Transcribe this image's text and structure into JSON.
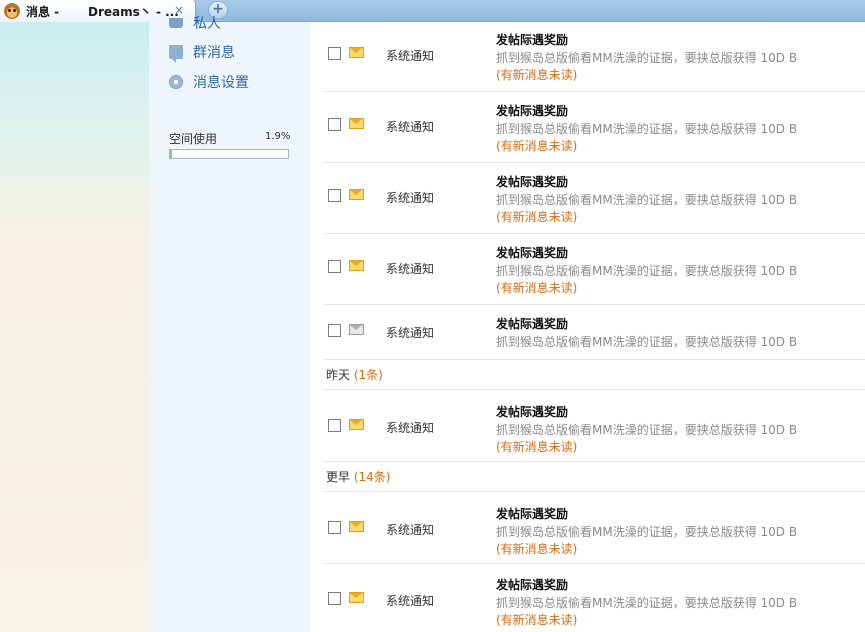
{
  "tab": {
    "title": "消息 -",
    "title2": "Dreams丶 - ...",
    "close_glyph": "×",
    "new_glyph": "+"
  },
  "sidebar": {
    "partial_label": "私人",
    "items": [
      {
        "label": "群消息",
        "icon": "chat-bubble-icon"
      },
      {
        "label": "消息设置",
        "icon": "gear-icon"
      }
    ],
    "space": {
      "label": "空间使用",
      "percent_text": "1.9%",
      "percent": 1.9
    }
  },
  "messages": {
    "today": [
      {
        "sender": "系统通知",
        "subject": "发帖际遇奖励",
        "body": "抓到猴岛总版偷看MM洗澡的证据，要挟总版获得 10D B",
        "unread": "(有新消息未读)",
        "read": false
      },
      {
        "sender": "系统通知",
        "subject": "发帖际遇奖励",
        "body": "抓到猴岛总版偷看MM洗澡的证据，要挟总版获得 10D B",
        "unread": "(有新消息未读)",
        "read": false
      },
      {
        "sender": "系统通知",
        "subject": "发帖际遇奖励",
        "body": "抓到猴岛总版偷看MM洗澡的证据，要挟总版获得 10D B",
        "unread": "(有新消息未读)",
        "read": false
      },
      {
        "sender": "系统通知",
        "subject": "发帖际遇奖励",
        "body": "抓到猴岛总版偷看MM洗澡的证据，要挟总版获得 10D B",
        "unread": "(有新消息未读)",
        "read": false
      },
      {
        "sender": "系统通知",
        "subject": "发帖际遇奖励",
        "body": "抓到猴岛总版偷看MM洗澡的证据，要挟总版获得 10D B",
        "unread": "",
        "read": true
      }
    ],
    "yesterday_group": {
      "label": "昨天",
      "count": "(1条)"
    },
    "yesterday": [
      {
        "sender": "系统通知",
        "subject": "发帖际遇奖励",
        "body": "抓到猴岛总版偷看MM洗澡的证据，要挟总版获得 10D B",
        "unread": "(有新消息未读)",
        "read": false
      }
    ],
    "earlier_group": {
      "label": "更早",
      "count": "(14条)"
    },
    "earlier": [
      {
        "sender": "系统通知",
        "subject": "发帖际遇奖励",
        "body": "抓到猴岛总版偷看MM洗澡的证据，要挟总版获得 10D B",
        "unread": "(有新消息未读)",
        "read": false
      },
      {
        "sender": "系统通知",
        "subject": "发帖际遇奖励",
        "body": "抓到猴岛总版偷看MM洗澡的证据，要挟总版获得 10D B",
        "unread": "(有新消息未读)",
        "read": false
      }
    ]
  }
}
